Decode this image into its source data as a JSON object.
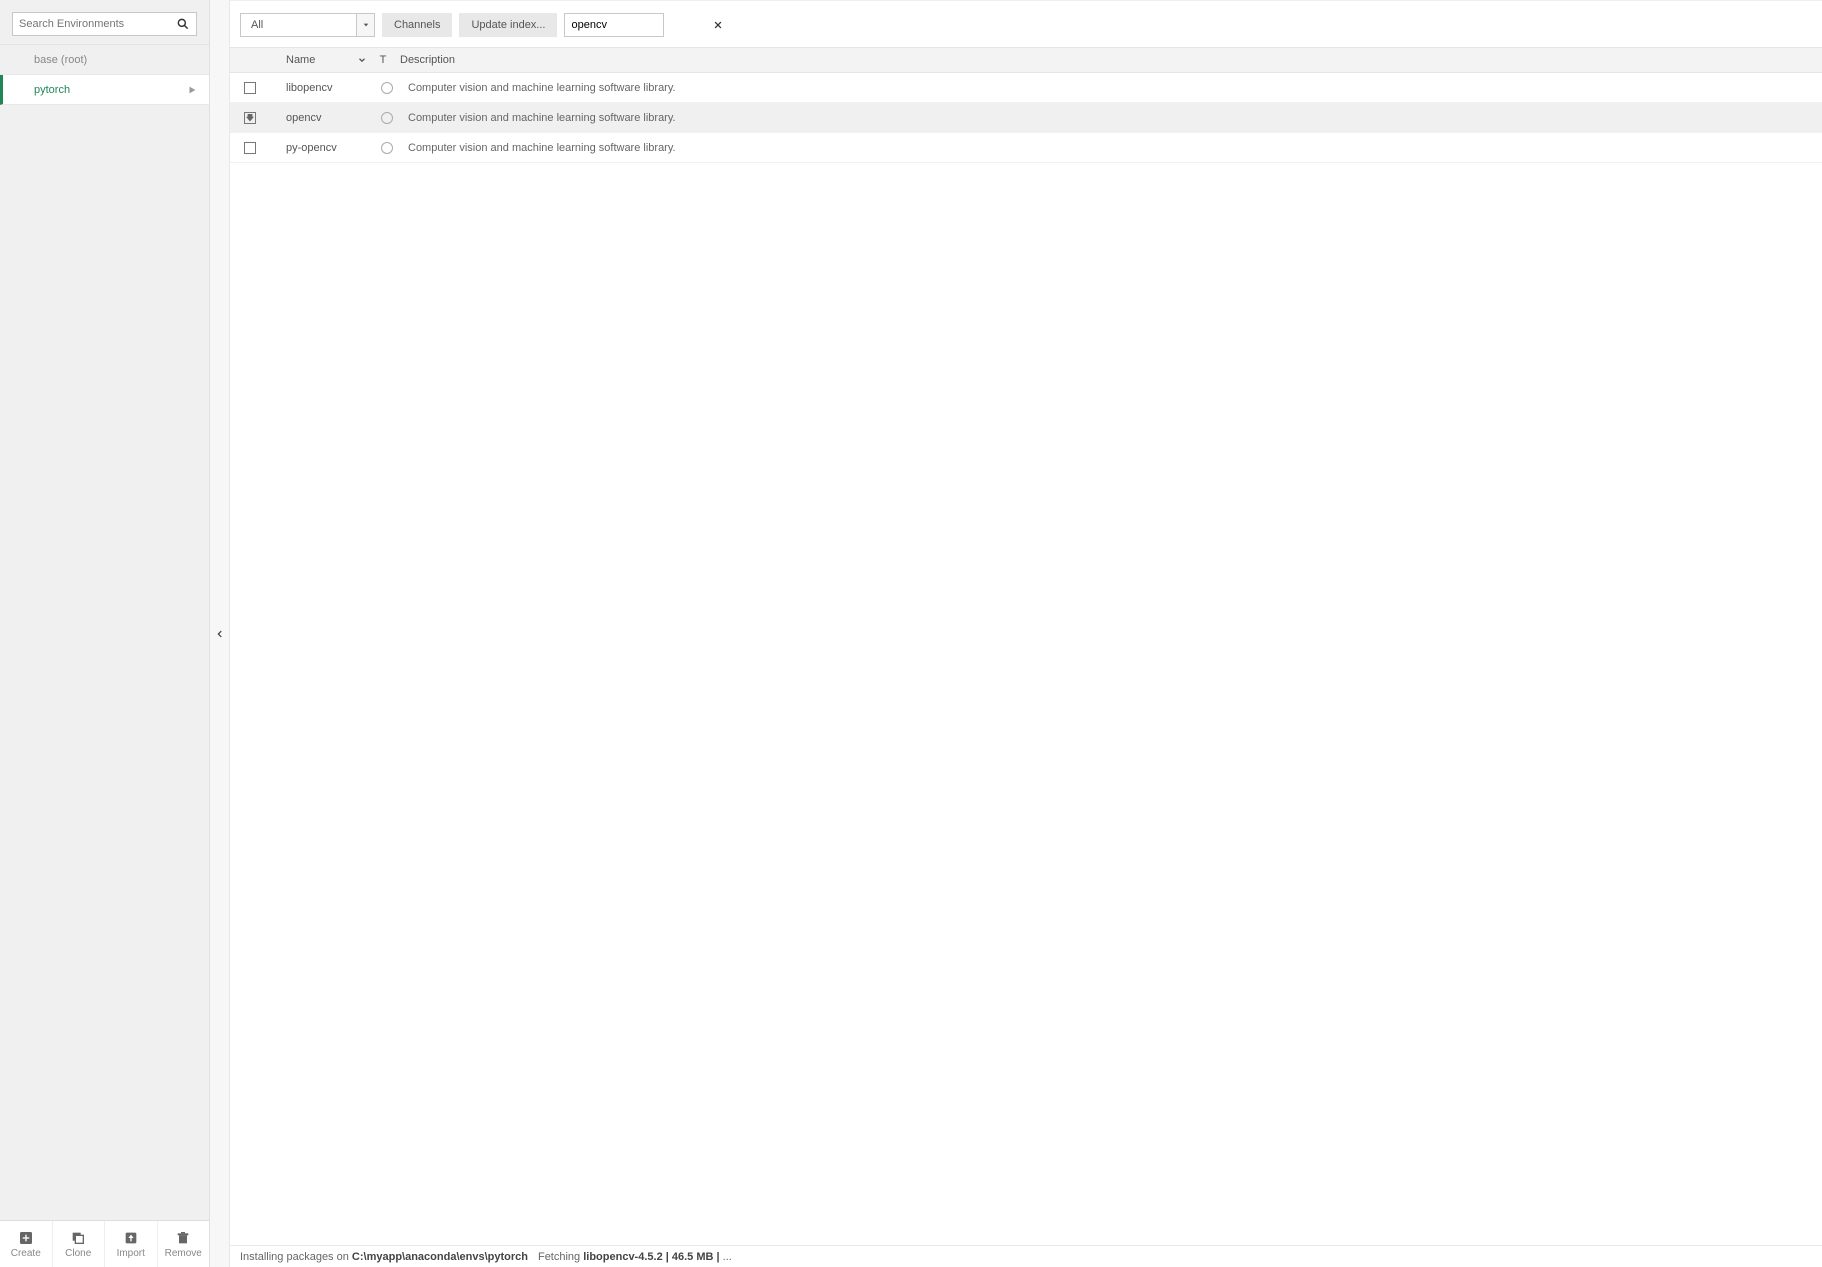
{
  "sidebar": {
    "search_placeholder": "Search Environments",
    "environments": [
      {
        "name": "base (root)",
        "selected": false
      },
      {
        "name": "pytorch",
        "selected": true
      }
    ],
    "actions": {
      "create": "Create",
      "clone": "Clone",
      "import": "Import",
      "remove": "Remove"
    }
  },
  "toolbar": {
    "filter_value": "All",
    "channels_label": "Channels",
    "update_label": "Update index...",
    "search_value": "opencv"
  },
  "table": {
    "headers": {
      "name": "Name",
      "t": "T",
      "description": "Description"
    },
    "rows": [
      {
        "checked": "empty",
        "name": "libopencv",
        "desc": "Computer vision and machine learning software library.",
        "hl": false
      },
      {
        "checked": "download",
        "name": "opencv",
        "desc": "Computer vision and machine learning software library.",
        "hl": true
      },
      {
        "checked": "empty",
        "name": "py-opencv",
        "desc": "Computer vision and machine learning software library.",
        "hl": false
      }
    ]
  },
  "status": {
    "prefix": "Installing packages on ",
    "path": "C:\\myapp\\anaconda\\envs\\pytorch",
    "fetch_prefix": "Fetching ",
    "fetch_pkg": "libopencv-4.5.2 | 46.5 MB | ",
    "suffix": "..."
  }
}
